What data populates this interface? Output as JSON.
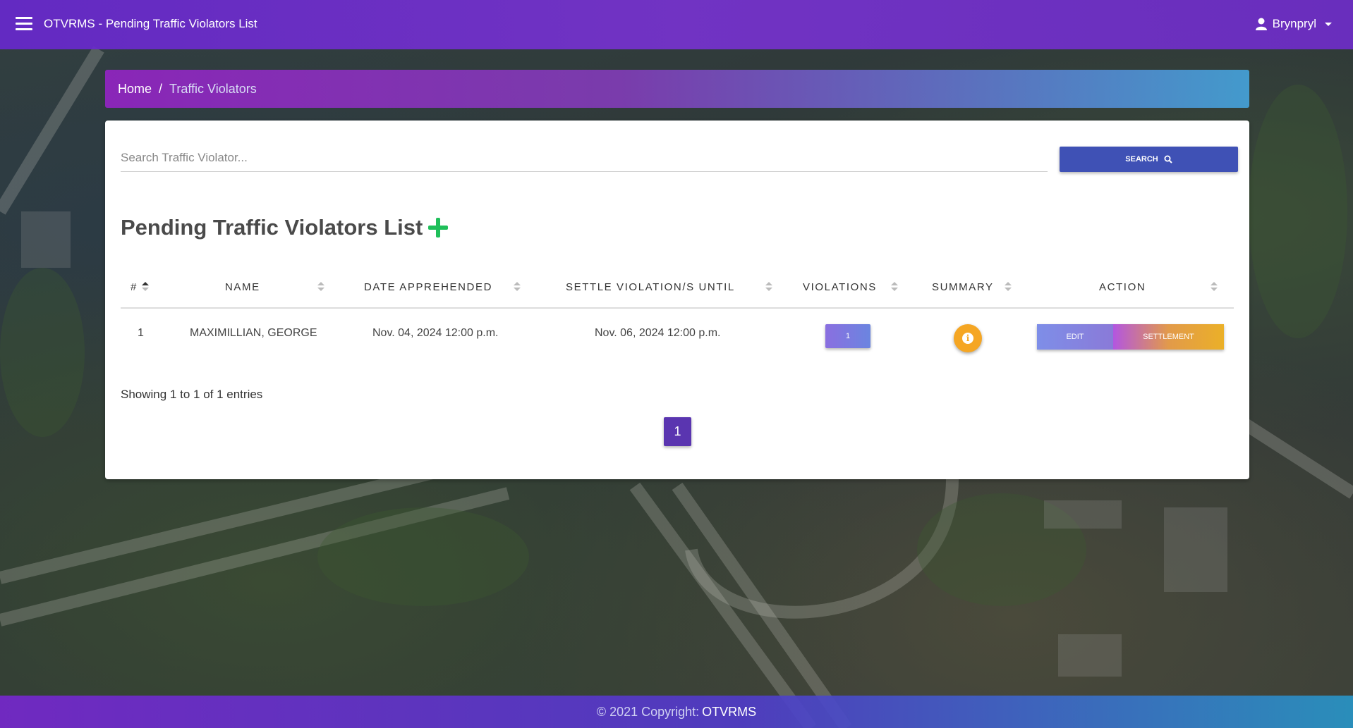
{
  "navbar": {
    "title": "OTVRMS - Pending Traffic Violators List",
    "user": "Brynpryl"
  },
  "breadcrumb": {
    "home": "Home",
    "separator": "/",
    "current": "Traffic Violators"
  },
  "search": {
    "placeholder": "Search Traffic Violator...",
    "value": "",
    "button_label": "SEARCH"
  },
  "page": {
    "title": "Pending Traffic Violators List"
  },
  "table": {
    "columns": [
      "#",
      "NAME",
      "DATE APPREHENDED",
      "SETTLE VIOLATION/S UNTIL",
      "VIOLATIONS",
      "SUMMARY",
      "ACTION"
    ],
    "rows": [
      {
        "number": "1",
        "name": "MAXIMILLIAN, GEORGE",
        "date_apprehended": "Nov. 04, 2024 12:00 p.m.",
        "settle_until": "Nov. 06, 2024 12:00 p.m.",
        "violations": "1",
        "summary_icon": "info-icon",
        "edit_label": "EDIT",
        "settlement_label": "SETTLEMENT"
      }
    ]
  },
  "pagination": {
    "info": "Showing 1 to 1 of 1 entries",
    "current_page": "1"
  },
  "footer": {
    "copyright": "© 2021 Copyright:",
    "brand": "OTVRMS"
  },
  "colors": {
    "navbar": "#6a2ccd",
    "search_button": "#3f51b5",
    "add_icon": "#1fbf5a",
    "summary_button": "#f5a623",
    "page_button": "#5a35b0"
  }
}
